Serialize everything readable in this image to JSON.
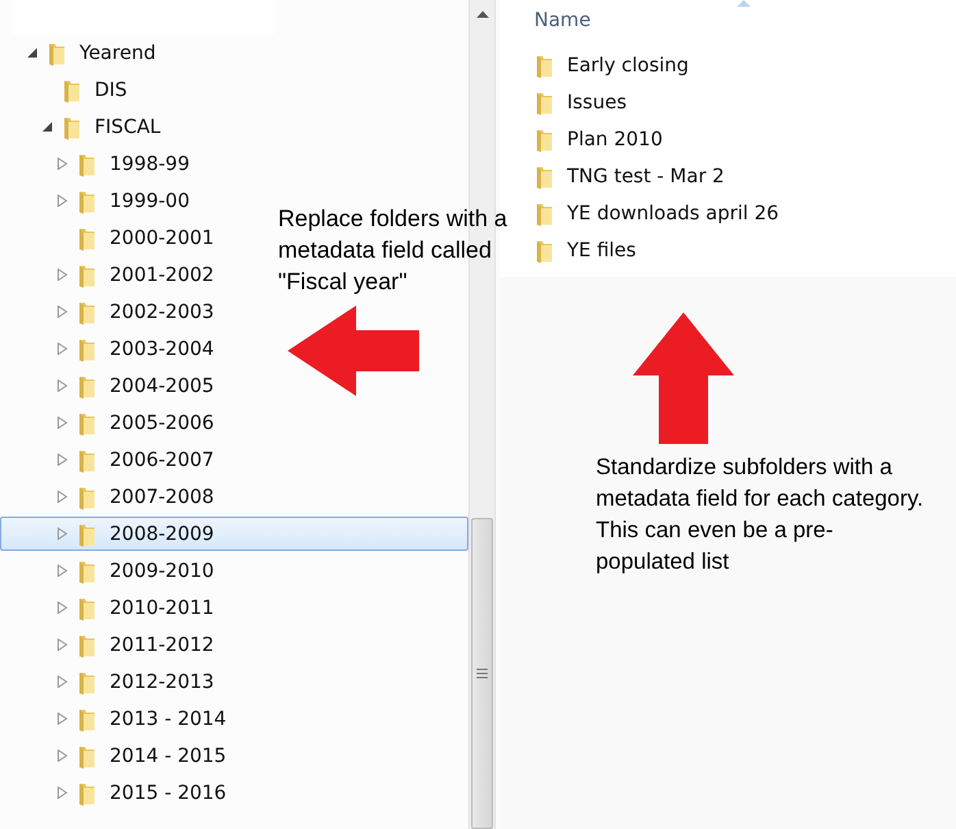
{
  "tree": [
    {
      "label": "Yearend",
      "expanded": true,
      "selected": false,
      "children": [
        {
          "label": "DIS",
          "selected": false
        },
        {
          "label": "FISCAL",
          "expanded": true,
          "selected": false,
          "children": [
            {
              "label": "1998-99",
              "expanded": false,
              "selected": false
            },
            {
              "label": "1999-00",
              "expanded": false,
              "selected": false
            },
            {
              "label": "2000-2001",
              "selected": false
            },
            {
              "label": "2001-2002",
              "expanded": false,
              "selected": false
            },
            {
              "label": "2002-2003",
              "expanded": false,
              "selected": false
            },
            {
              "label": "2003-2004",
              "expanded": false,
              "selected": false
            },
            {
              "label": "2004-2005",
              "expanded": false,
              "selected": false
            },
            {
              "label": "2005-2006",
              "expanded": false,
              "selected": false
            },
            {
              "label": "2006-2007",
              "expanded": false,
              "selected": false
            },
            {
              "label": "2007-2008",
              "expanded": false,
              "selected": false
            },
            {
              "label": "2008-2009",
              "expanded": false,
              "selected": true
            },
            {
              "label": "2009-2010",
              "expanded": false,
              "selected": false
            },
            {
              "label": "2010-2011",
              "expanded": false,
              "selected": false
            },
            {
              "label": "2011-2012",
              "expanded": false,
              "selected": false
            },
            {
              "label": "2012-2013",
              "expanded": false,
              "selected": false
            },
            {
              "label": "2013 - 2014",
              "expanded": false,
              "selected": false
            },
            {
              "label": "2014 - 2015",
              "expanded": false,
              "selected": false
            },
            {
              "label": "2015 - 2016",
              "expanded": false,
              "selected": false
            }
          ]
        }
      ]
    }
  ],
  "file_list": {
    "column_header": "Name",
    "items": [
      "Early closing",
      "Issues",
      "Plan 2010",
      "TNG test - Mar 2",
      "YE downloads april 26",
      "YE files"
    ]
  },
  "annotations": [
    {
      "text": "Replace folders with a metadata field called \"Fiscal year\"",
      "kind": "left-arrow"
    },
    {
      "text": "Standardize subfolders with a metadata field for each category. This can even be a pre-populated list",
      "kind": "up-arrow"
    }
  ]
}
